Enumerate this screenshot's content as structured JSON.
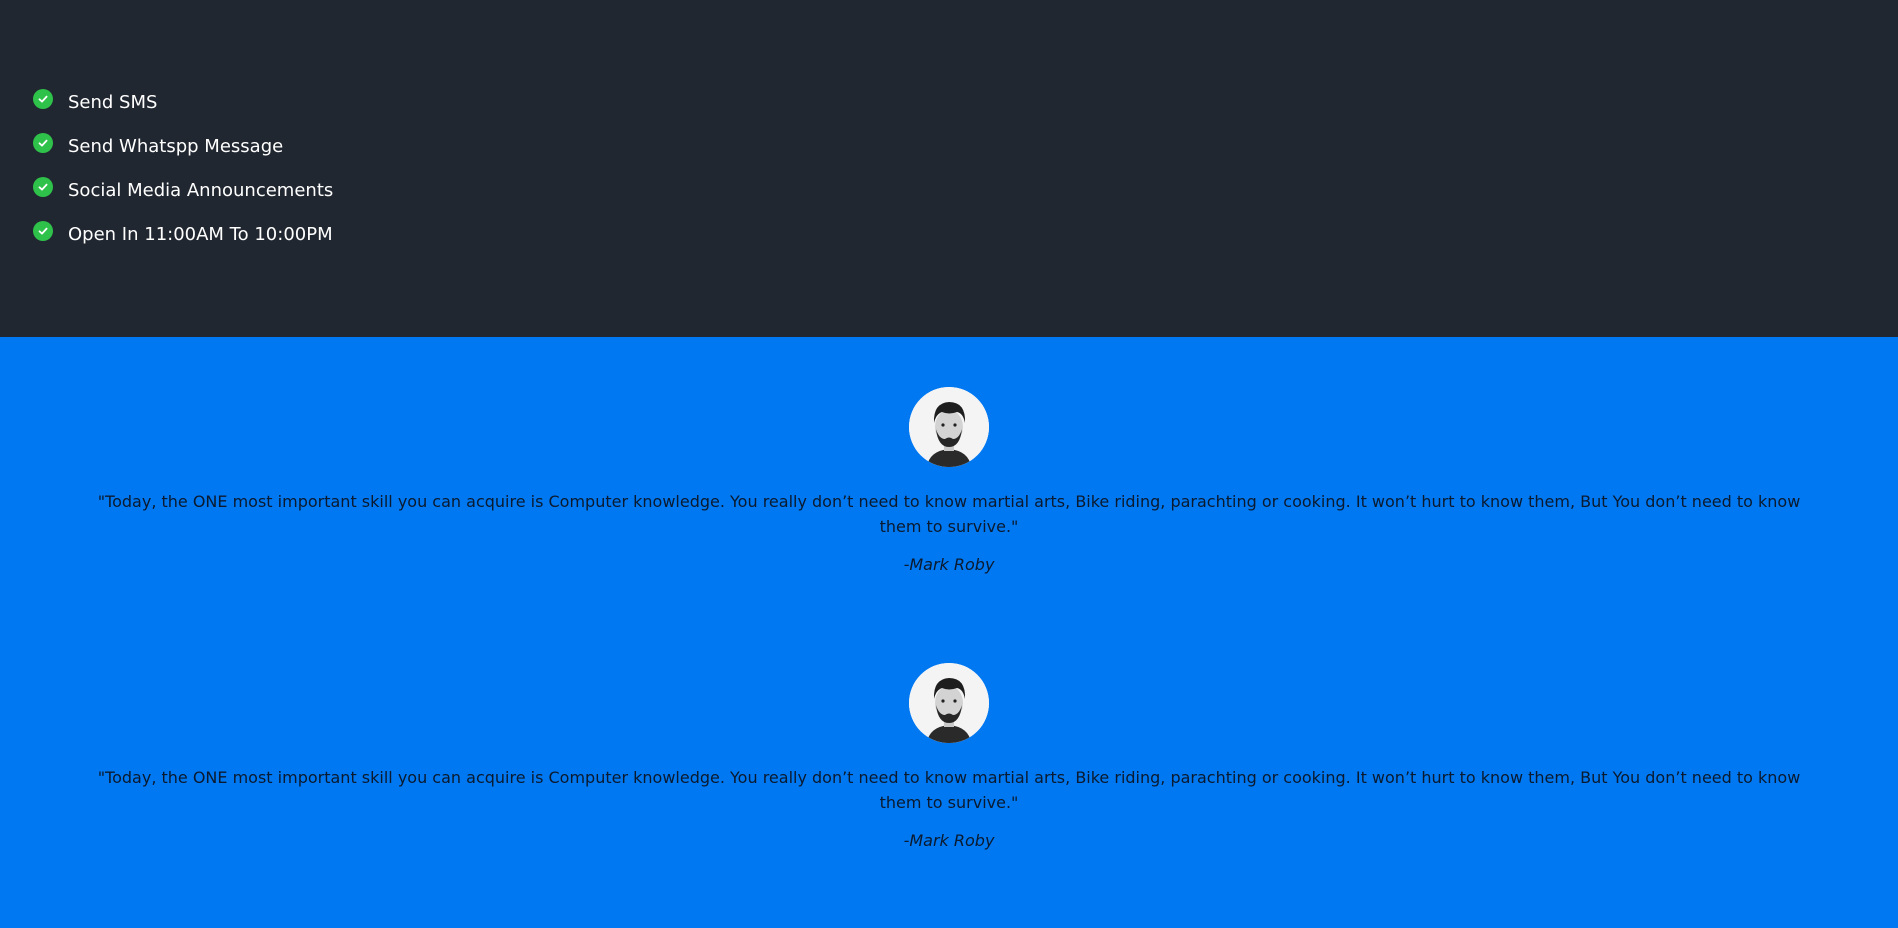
{
  "features": {
    "items": [
      {
        "label": "Send SMS",
        "icon": "check-circle-icon"
      },
      {
        "label": "Send Whatspp Message",
        "icon": "check-circle-icon"
      },
      {
        "label": "Social Media Announcements",
        "icon": "check-circle-icon"
      },
      {
        "label": "Open In 11:00AM To 10:00PM",
        "icon": "check-circle-icon"
      }
    ]
  },
  "testimonials": [
    {
      "quote": "\"Today, the ONE most important skill you can acquire is Computer knowledge. You really don’t need to know martial arts, Bike riding, parachting or cooking. It won’t hurt to know them, But You don’t need to know them to survive.\"",
      "author": "-Mark Roby"
    },
    {
      "quote": "\"Today, the ONE most important skill you can acquire is Computer knowledge. You really don’t need to know martial arts, Bike riding, parachting or cooking. It won’t hurt to know them, But You don’t need to know them to survive.\"",
      "author": "-Mark Roby"
    }
  ],
  "colors": {
    "dark_background": "#212730",
    "accent_blue": "#0078f2",
    "check_green": "#2ec24a",
    "text_dark": "#0b1a2e"
  }
}
